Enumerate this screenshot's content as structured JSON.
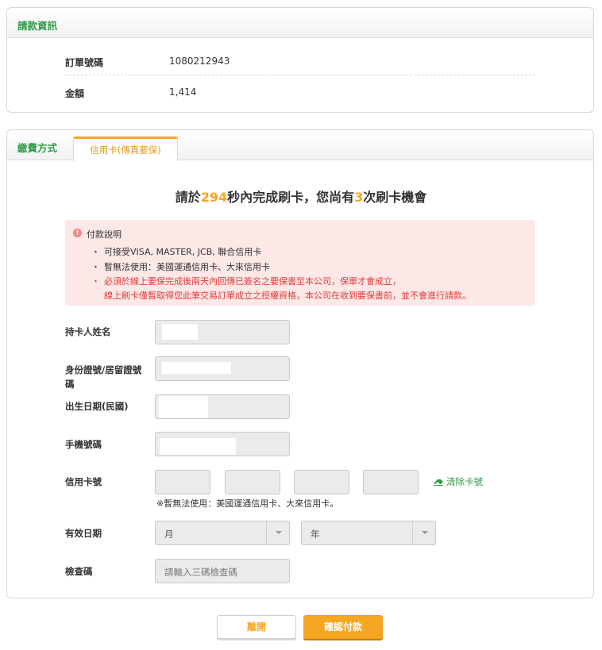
{
  "billing": {
    "title": "請款資訊",
    "order_label": "訂單號碼",
    "order_value": "1080212943",
    "amount_label": "金額",
    "amount_value": "1,414"
  },
  "payment": {
    "title": "繳費方式",
    "tab_label": "信用卡(傳真要保)",
    "countdown": {
      "prefix": "請於",
      "seconds": "294",
      "middle": "秒內完成刷卡，您尚有",
      "attempts": "3",
      "suffix": "次刷卡機會"
    },
    "notice": {
      "title": "付款說明",
      "bullet": "・",
      "items": [
        "可接受VISA, MASTER, JCB, 聯合信用卡",
        "暫無法使用：美國運通信用卡、大來信用卡",
        "必須於線上要保完成後兩天內回傳已簽名之要保書至本公司，保單才會成立，"
      ],
      "continuation": "線上刷卡僅暫取得您此筆交易訂單成立之授權資格，本公司在收到要保書前，並不會進行請款。"
    },
    "form": {
      "holder_label": "持卡人姓名",
      "id_label_line1": "身份證號/居留證號",
      "id_label_line2": "碼",
      "dob_label": "出生日期(民國)",
      "phone_label": "手機號碼",
      "card_label": "信用卡號",
      "card_note": "※暫無法使用：美國運通信用卡、大來信用卡。",
      "clear_label": "清除卡號",
      "expiry_label": "有效日期",
      "month_value": "月",
      "year_value": "年",
      "cvv_label": "檢查碼",
      "cvv_placeholder": "請輸入三碼檢查碼"
    }
  },
  "actions": {
    "leave_label": "離開",
    "confirm_label": "確認付款"
  },
  "colors": {
    "section_title": "#2f9a46",
    "accent": "#f5a623",
    "warning_text": "#e53935",
    "notice_bg": "#fde8e8"
  }
}
